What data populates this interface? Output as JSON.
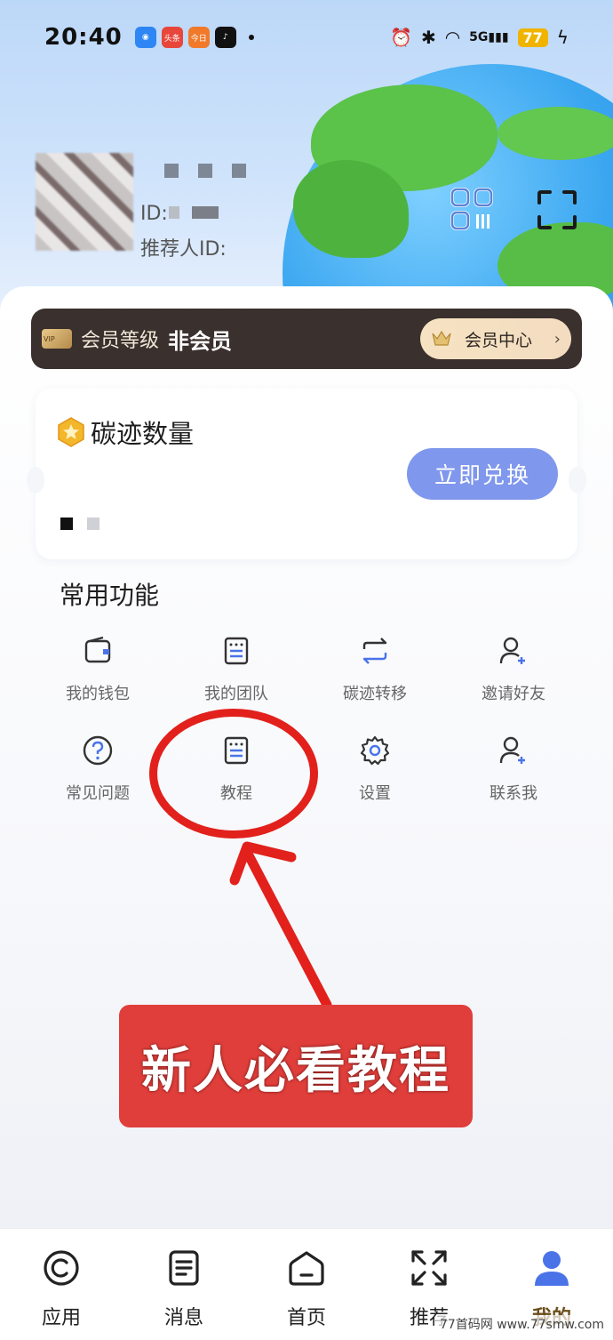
{
  "status_bar": {
    "time": "20:40",
    "notif_labels": [
      "头条",
      "今日"
    ],
    "battery": "77"
  },
  "profile": {
    "id_label": "ID:",
    "referrer_label": "推荐人ID:"
  },
  "membership": {
    "vip_tag": "VIP",
    "level_label": "会员等级",
    "level_value": "非会员",
    "center_label": "会员中心",
    "chevron": "›"
  },
  "carbon": {
    "title": "碳迹数量",
    "redeem_label": "立即兑换"
  },
  "common_functions": {
    "title": "常用功能",
    "items": [
      {
        "label": "我的钱包",
        "icon": "wallet-icon"
      },
      {
        "label": "我的团队",
        "icon": "team-icon"
      },
      {
        "label": "碳迹转移",
        "icon": "transfer-icon"
      },
      {
        "label": "邀请好友",
        "icon": "invite-friend-icon"
      },
      {
        "label": "常见问题",
        "icon": "question-icon"
      },
      {
        "label": "教程",
        "icon": "tutorial-icon"
      },
      {
        "label": "设置",
        "icon": "gear-icon"
      },
      {
        "label": "联系我",
        "icon": "contact-icon"
      }
    ]
  },
  "annotation": {
    "banner_text": "新人必看教程",
    "color": "#e2211c"
  },
  "tabbar": {
    "items": [
      {
        "label": "应用",
        "icon": "apps-icon"
      },
      {
        "label": "消息",
        "icon": "message-icon"
      },
      {
        "label": "首页",
        "icon": "home-icon"
      },
      {
        "label": "推荐",
        "icon": "expand-icon"
      },
      {
        "label": "我的",
        "icon": "user-icon",
        "active": true
      }
    ]
  },
  "watermark": "77首码网 www.77smw.com",
  "colors": {
    "accent_blue": "#7f97ec",
    "member_bar": "#3a302d",
    "active_tab": "#6b4e1a",
    "icon_blue": "#4a73e8"
  }
}
